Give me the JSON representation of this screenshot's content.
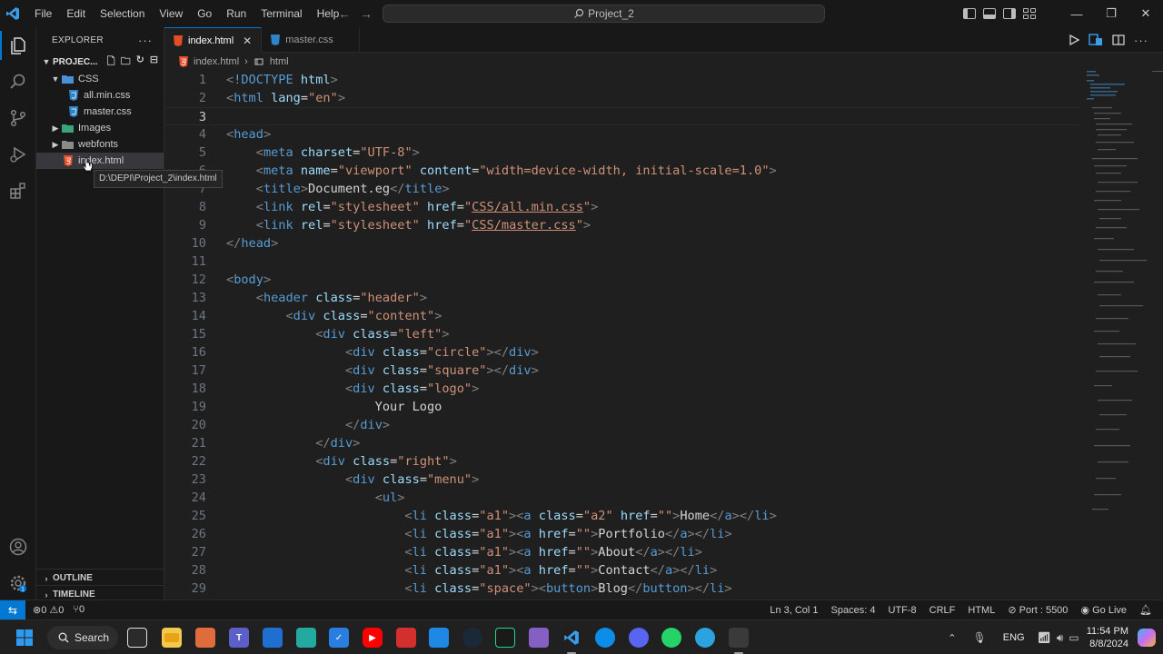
{
  "titlebar": {
    "menu": [
      "File",
      "Edit",
      "Selection",
      "View",
      "Go",
      "Run",
      "Terminal",
      "Help"
    ],
    "search_text": "Project_2"
  },
  "sidebar": {
    "title": "EXPLORER",
    "more": "···",
    "project": "PROJEC...",
    "tree": [
      {
        "label": "CSS",
        "type": "folder-open",
        "depth": 1
      },
      {
        "label": "all.min.css",
        "type": "css",
        "depth": 2
      },
      {
        "label": "master.css",
        "type": "css",
        "depth": 2
      },
      {
        "label": "Images",
        "type": "folder",
        "depth": 1
      },
      {
        "label": "webfonts",
        "type": "folder",
        "depth": 1
      },
      {
        "label": "index.html",
        "type": "html",
        "depth": 1,
        "selected": true
      }
    ],
    "tooltip": "D:\\DEPI\\Project_2\\index.html",
    "outline": "OUTLINE",
    "timeline": "TIMELINE"
  },
  "tabs": [
    {
      "label": "index.html",
      "active": true
    },
    {
      "label": "master.css",
      "active": false
    }
  ],
  "breadcrumb": {
    "file": "index.html",
    "symbol": "html"
  },
  "code": {
    "current_line": 3,
    "lines": [
      "<!DOCTYPE html>",
      "<html lang=\"en\">",
      "",
      "<head>",
      "    <meta charset=\"UTF-8\">",
      "    <meta name=\"viewport\" content=\"width=device-width, initial-scale=1.0\">",
      "    <title>Document.eg</title>",
      "    <link rel=\"stylesheet\" href=\"CSS/all.min.css\">",
      "    <link rel=\"stylesheet\" href=\"CSS/master.css\">",
      "</head>",
      "",
      "<body>",
      "    <header class=\"header\">",
      "        <div class=\"content\">",
      "            <div class=\"left\">",
      "                <div class=\"circle\"></div>",
      "                <div class=\"square\"></div>",
      "                <div class=\"logo\">",
      "                    Your Logo",
      "                </div>",
      "            </div>",
      "            <div class=\"right\">",
      "                <div class=\"menu\">",
      "                    <ul>",
      "                        <li class=\"a1\"><a class=\"a2\" href=\"\">Home</a></li>",
      "                        <li class=\"a1\"><a href=\"\">Portfolio</a></li>",
      "                        <li class=\"a1\"><a href=\"\">About</a></li>",
      "                        <li class=\"a1\"><a href=\"\">Contact</a></li>",
      "                        <li class=\"space\"><button>Blog</button></li>"
    ]
  },
  "status": {
    "errors": "0",
    "warnings": "0",
    "ports": "0",
    "position": "Ln 3, Col 1",
    "spaces": "Spaces: 4",
    "encoding": "UTF-8",
    "eol": "CRLF",
    "language": "HTML",
    "port": "Port : 5500",
    "golive": "Go Live"
  },
  "taskbar": {
    "search": "Search",
    "lang": "ENG",
    "time": "11:54 PM",
    "date": "8/8/2024"
  },
  "colors": {
    "accent": "#0078d4",
    "tag": "#569cd6",
    "attr": "#9cdcfe",
    "string": "#ce9178",
    "text": "#d4d4d4"
  }
}
